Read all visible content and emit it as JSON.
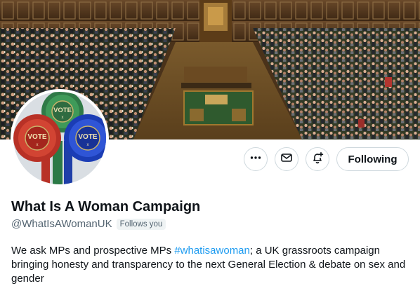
{
  "profile": {
    "display_name": "What Is A Woman Campaign",
    "handle": "@WhatIsAWomanUK",
    "follows_you_badge": "Follows you",
    "bio": {
      "before": "We ask MPs and prospective MPs ",
      "hashtag": "#whatisawoman",
      "after": "; a UK grassroots campaign bringing honesty and transparency to the next General Election & debate on sex and gender"
    }
  },
  "avatar": {
    "rosettes": [
      {
        "label": "VOTE",
        "mark": "x",
        "color": "#3f8f57"
      },
      {
        "label": "VOTE",
        "mark": "x",
        "color": "#c93a2b"
      },
      {
        "label": "VOTE",
        "mark": "x",
        "color": "#1f45c9"
      }
    ]
  },
  "actions": {
    "more_icon": "more-dots-icon",
    "message_icon": "envelope-icon",
    "notify_icon": "bell-plus-icon",
    "follow_label": "Following"
  },
  "colors": {
    "link": "#1d9bf0",
    "text_primary": "#0f1419",
    "text_secondary": "#536471",
    "border": "#cfd9de"
  }
}
